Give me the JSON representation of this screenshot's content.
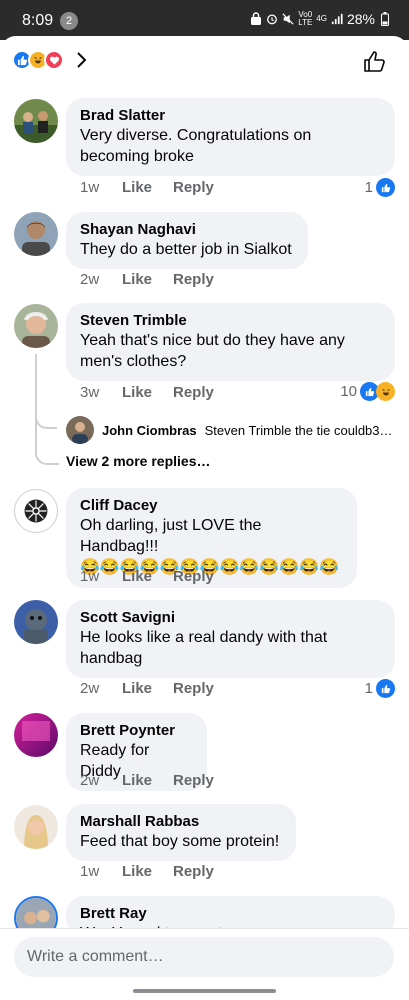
{
  "status_bar": {
    "time": "8:09",
    "notification_count": "2",
    "network_top": "Vo0",
    "network_bottom": "LTE",
    "network_gen": "4G",
    "battery": "28%"
  },
  "header": {
    "reaction_icons": [
      "like-icon",
      "haha-icon",
      "love-icon"
    ]
  },
  "comments": [
    {
      "author": "Brad Slatter",
      "lines": [
        "Very diverse. Congratulations on",
        "becoming broke"
      ],
      "time": "1w",
      "like": "Like",
      "reply": "Reply",
      "reaction_count": "1",
      "reactions": [
        "like-icon"
      ]
    },
    {
      "author": "Shayan Naghavi",
      "lines": [
        "They do a better job in Sialkot"
      ],
      "time": "2w",
      "like": "Like",
      "reply": "Reply"
    },
    {
      "author": "Steven Trimble",
      "lines": [
        "Yeah that's nice but do they have any",
        "men's clothes?"
      ],
      "time": "3w",
      "like": "Like",
      "reply": "Reply",
      "reaction_count": "10",
      "reactions": [
        "like-icon",
        "haha-icon"
      ]
    },
    {
      "author": "Cliff Dacey",
      "lines": [
        "Oh darling, just LOVE the Handbag!!!",
        "😂😂😂😂😂😂😂😂😂😂😂😂😂"
      ],
      "time": "1w",
      "like": "Like",
      "reply": "Reply"
    },
    {
      "author": "Scott Savigni",
      "lines": [
        "He looks like a real dandy with that",
        "handbag"
      ],
      "time": "2w",
      "like": "Like",
      "reply": "Reply",
      "reaction_count": "1",
      "reactions": [
        "like-icon"
      ]
    },
    {
      "author": "Brett Poynter",
      "lines": [
        "Ready for Diddy"
      ],
      "time": "2w",
      "like": "Like",
      "reply": "Reply"
    },
    {
      "author": "Marshall Rabbas",
      "lines": [
        "Feed that boy some protein!"
      ],
      "time": "1w",
      "like": "Like",
      "reply": "Reply"
    },
    {
      "author": "Brett Ray",
      "lines": [
        "W... Y... ...d t... ... ...t ..."
      ],
      "time": "",
      "like": "",
      "reply": ""
    }
  ],
  "reply_preview": {
    "author": "John Ciombras",
    "snippet": "Steven Trimble the tie couldb3…"
  },
  "view_more": "View 2 more replies…",
  "composer": {
    "placeholder": "Write a comment…"
  },
  "colors": {
    "accent": "#1877f2",
    "bubble": "#f0f2f5",
    "meta_text": "#65676b"
  }
}
